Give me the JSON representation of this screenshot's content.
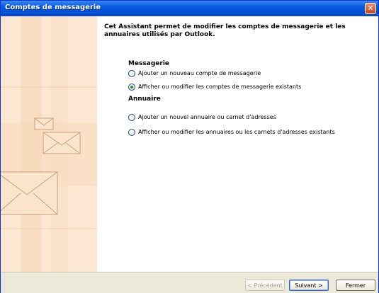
{
  "window": {
    "title": "Comptes de messagerie",
    "close_glyph": "✕"
  },
  "intro": "Cet Assistant permet de modifier les comptes de messagerie et les annuaires utilisés par Outlook.",
  "messagerie": {
    "heading": "Messagerie",
    "options": [
      {
        "label": "Ajouter un nouveau compte de messagerie",
        "checked": false
      },
      {
        "label": "Afficher ou modifier les comptes de messagerie existants",
        "checked": true
      }
    ]
  },
  "annuaire": {
    "heading": "Annuaire",
    "options": [
      {
        "label": "Ajouter un nouvel annuaire ou carnet d'adresses",
        "checked": false
      },
      {
        "label": "Afficher ou modifier les annuaires ou les carnets d'adresses existants",
        "checked": false
      }
    ]
  },
  "buttons": {
    "previous": "< Précédent",
    "next": "Suivant >",
    "close": "Fermer"
  },
  "icons": {
    "close": "close-icon",
    "radio": "radio-icon",
    "envelope": "envelope-icon"
  }
}
